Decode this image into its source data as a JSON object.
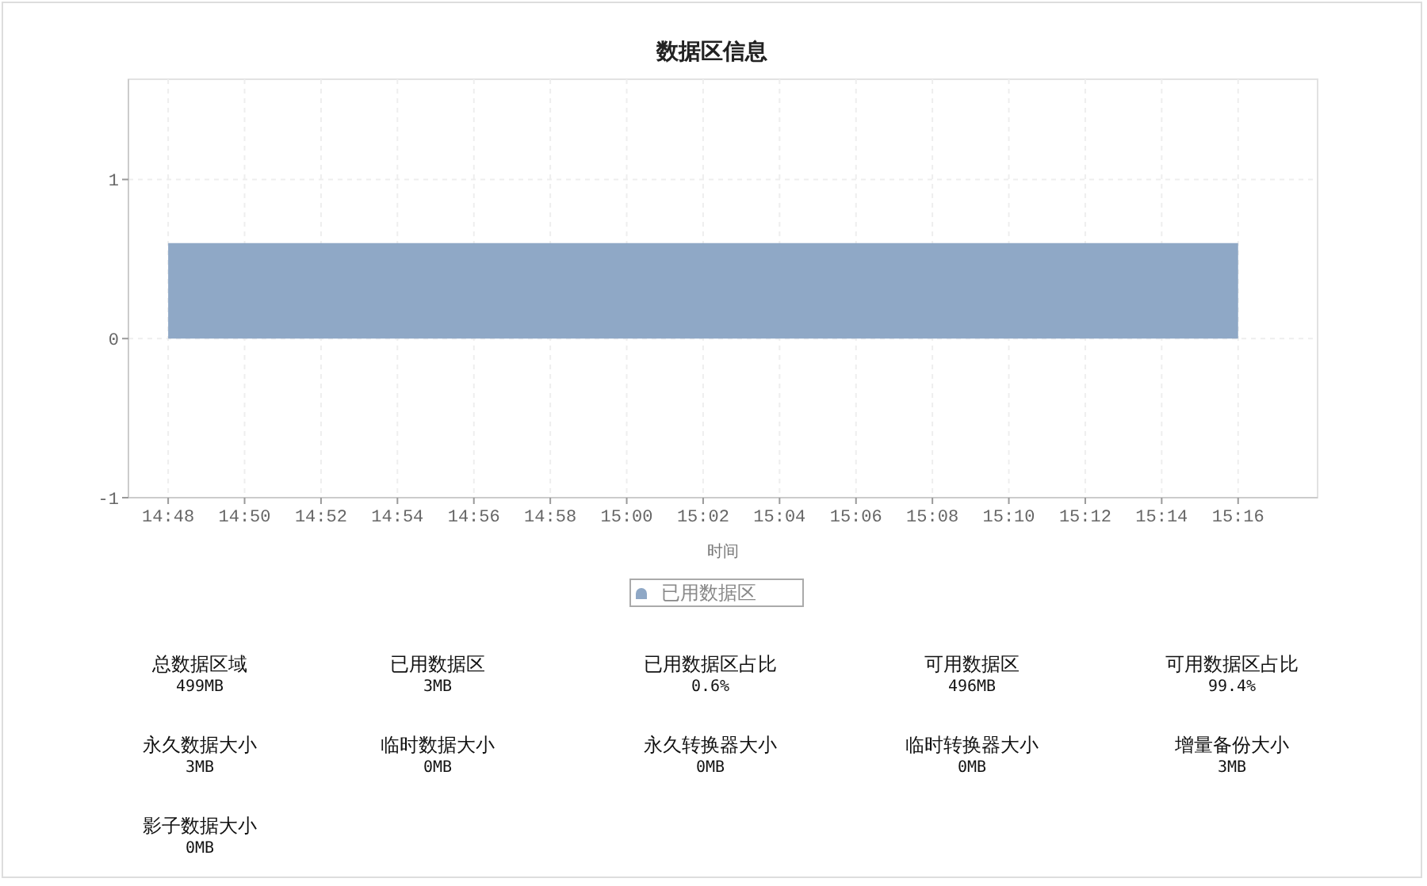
{
  "title": "数据区信息",
  "chart_data": {
    "type": "area",
    "xlabel": "时间",
    "categories": [
      "14:48",
      "14:50",
      "14:52",
      "14:54",
      "14:56",
      "14:58",
      "15:00",
      "15:02",
      "15:04",
      "15:06",
      "15:08",
      "15:10",
      "15:12",
      "15:14",
      "15:16"
    ],
    "series": [
      {
        "name": "已用数据区",
        "color": "#8fa8c6",
        "values": [
          0.6,
          0.6,
          0.6,
          0.6,
          0.6,
          0.6,
          0.6,
          0.6,
          0.6,
          0.6,
          0.6,
          0.6,
          0.6,
          0.6,
          0.6
        ]
      }
    ],
    "ylim": [
      -1,
      1.63
    ],
    "yticks": [
      -1,
      0,
      1
    ],
    "grid": true
  },
  "stats": [
    {
      "label": "总数据区域",
      "value": "499MB"
    },
    {
      "label": "已用数据区",
      "value": "3MB"
    },
    {
      "label": "已用数据区占比",
      "value": "0.6%"
    },
    {
      "label": "可用数据区",
      "value": "496MB"
    },
    {
      "label": "可用数据区占比",
      "value": "99.4%"
    },
    {
      "label": "永久数据大小",
      "value": "3MB"
    },
    {
      "label": "临时数据大小",
      "value": "0MB"
    },
    {
      "label": "永久转换器大小",
      "value": "0MB"
    },
    {
      "label": "临时转换器大小",
      "value": "0MB"
    },
    {
      "label": "增量备份大小",
      "value": "3MB"
    },
    {
      "label": "影子数据大小",
      "value": "0MB"
    }
  ]
}
